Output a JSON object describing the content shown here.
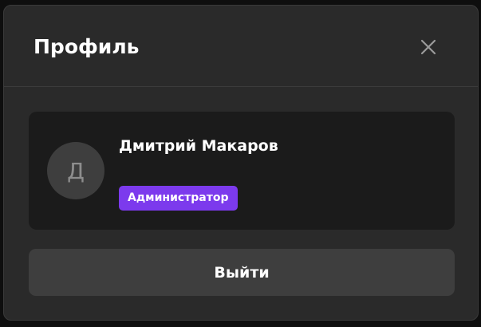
{
  "modal": {
    "title": "Профиль",
    "close_icon": "close-icon"
  },
  "profile": {
    "avatar_initial": "Д",
    "name": "Дмитрий Макаров",
    "role": "Администратор"
  },
  "actions": {
    "logout_label": "Выйти"
  },
  "colors": {
    "modal_background": "#2a2a2a",
    "card_background": "#1b1b1b",
    "avatar_background": "#3e3e3e",
    "badge_accent": "#7c3aed",
    "button_background": "#3e3e3e",
    "text_primary": "#ffffff",
    "icon_muted": "#9a9a9a"
  }
}
